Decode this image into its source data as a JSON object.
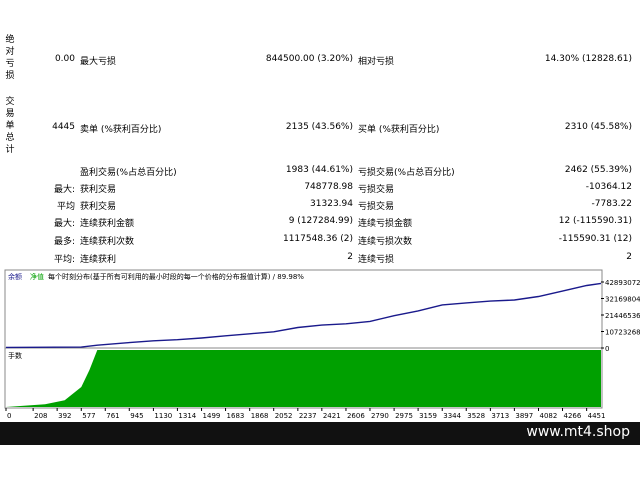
{
  "side_labels": {
    "absolute": [
      "绝",
      "对",
      "亏",
      "损"
    ],
    "trade": [
      "交",
      "易",
      "单",
      "总",
      "计"
    ]
  },
  "rows": [
    {
      "v1": "0.00",
      "k2": "最大亏损",
      "v2": "844500.00 (3.20%)",
      "k3": "相对亏损",
      "v3": "14.30% (12828.61)"
    },
    {
      "v1": "4445",
      "k2": "卖单 (%获利百分比)",
      "v2": "2135 (43.56%)",
      "k3": "买单 (%获利百分比)",
      "v3": "2310 (45.58%)"
    },
    {
      "k1": "",
      "k2": "盈利交易(%占总百分比)",
      "v2": "1983 (44.61%)",
      "k3": "亏损交易(%占总百分比)",
      "v3": "2462 (55.39%)"
    },
    {
      "k1": "最大:",
      "k2": "获利交易",
      "v2": "748778.98",
      "k3": "亏损交易",
      "v3": "-10364.12"
    },
    {
      "k1": "平均",
      "k2": "获利交易",
      "v2": "31323.94",
      "k3": "亏损交易",
      "v3": "-7783.22"
    },
    {
      "k1": "最大:",
      "k2": "连续获利金额",
      "v2": "9 (127284.99)",
      "k3": "连续亏损金额",
      "v3": "12 (-115590.31)"
    },
    {
      "k1": "最多:",
      "k2": "连续获利次数",
      "v2": "1117548.36 (2)",
      "k3": "连续亏损次数",
      "v3": "-115590.31 (12)"
    },
    {
      "k1": "平均:",
      "k2": "连续获利",
      "v2": "2",
      "k3": "连续亏损",
      "v3": "2"
    }
  ],
  "chart_header": {
    "tab1": "余额",
    "tab2": "净值",
    "caption": "每个时刻分布(基于所有可利用的最小时段的每一个价格的分布报值计算) / 89.98%"
  },
  "volume_label": "手数",
  "colors": {
    "balance": "#1a1a8c",
    "volume": "#00a000",
    "tab1": "#1a1a8c",
    "tab2": "#00a000"
  },
  "chart_data": {
    "type": "line",
    "x_ticks": [
      0,
      208,
      392,
      577,
      761,
      945,
      1130,
      1314,
      1499,
      1683,
      1868,
      2052,
      2237,
      2421,
      2606,
      2790,
      2975,
      3159,
      3344,
      3528,
      3713,
      3897,
      4082,
      4266,
      4451
    ],
    "y_ticks": [
      0,
      10723268,
      21446536,
      32169804,
      42893072
    ],
    "ylim": [
      0,
      42893072
    ],
    "xlim": [
      0,
      4561
    ],
    "series": [
      {
        "x": [
          0,
          577,
          700,
          945,
          1130,
          1314,
          1499,
          1683,
          1868,
          2052,
          2237,
          2421,
          2606,
          2790,
          2975,
          3159,
          3344,
          3528,
          3713,
          3897,
          4082,
          4266,
          4451,
          4561
        ],
        "y": [
          400000,
          600000,
          1800000,
          3500000,
          4700000,
          5400000,
          6500000,
          7900000,
          9200000,
          10500000,
          13300000,
          14900000,
          15700000,
          17300000,
          21000000,
          24100000,
          28000000,
          29300000,
          30500000,
          31200000,
          33500000,
          37000000,
          40600000,
          42000000
        ]
      }
    ],
    "volume": {
      "x": [
        0,
        300,
        450,
        577,
        640,
        700,
        761,
        4561
      ],
      "y": [
        0,
        0.05,
        0.12,
        0.35,
        0.65,
        1,
        1,
        1
      ]
    }
  },
  "footer": "www.mt4.shop"
}
